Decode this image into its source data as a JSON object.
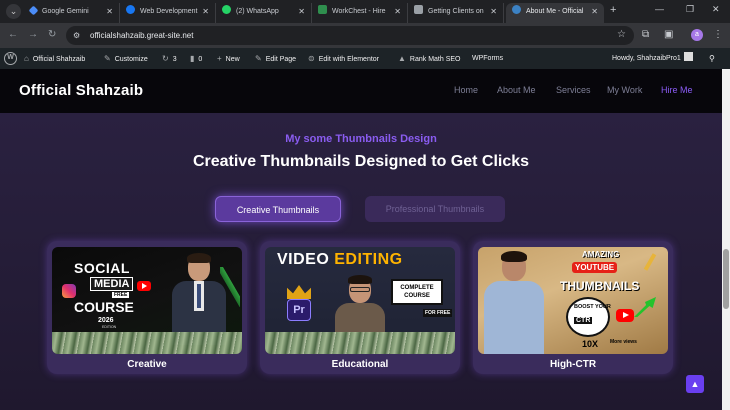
{
  "browser": {
    "tabs": [
      {
        "label": "Google Gemini",
        "favicon_color": "#4b8df8"
      },
      {
        "label": "Web Development",
        "favicon_color": "#1877f2"
      },
      {
        "label": "(2) WhatsApp",
        "favicon_color": "#25d366"
      },
      {
        "label": "WorkChest - Hire",
        "favicon_color": "#2f8f4e"
      },
      {
        "label": "Getting Clients on",
        "favicon_color": "#9aa0a6"
      },
      {
        "label": "About Me - Official",
        "favicon_color": "#3c82c4",
        "active": true
      }
    ],
    "url": "officialshahzaib.great-site.net",
    "profile_initial": "a"
  },
  "adminbar": {
    "site_name": "Official Shahzaib",
    "customize": "Customize",
    "updates_count": "3",
    "comments_count": "0",
    "new": "New",
    "edit_page": "Edit Page",
    "edit_elementor": "Edit with Elementor",
    "rank_math": "Rank Math SEO",
    "wpforms": "WPForms",
    "howdy": "Howdy, ShahzaibPro1"
  },
  "header": {
    "logo": "Official Shahzaib",
    "nav": [
      {
        "label": "Home"
      },
      {
        "label": "About Me"
      },
      {
        "label": "Services"
      },
      {
        "label": "My Work"
      },
      {
        "label": "Hire Me",
        "highlight": true
      }
    ]
  },
  "section": {
    "eyebrow": "My some Thumbnails Design",
    "headline": "Creative Thumbnails Designed to Get Clicks",
    "filters": [
      {
        "label": "Creative Thumbnails",
        "active": true
      },
      {
        "label": "Professional Thumbnails",
        "active": false
      }
    ],
    "cards": [
      {
        "label": "Creative",
        "thumb": {
          "l1": "SOCIAL",
          "l2": "MEDIA",
          "l3": "FREE",
          "l4": "COURSE",
          "l5": "2026",
          "l6": "EDITION"
        }
      },
      {
        "label": "Educational",
        "thumb": {
          "l1a": "VIDEO ",
          "l1b": "EDITING",
          "box": "COMPLETE COURSE",
          "free": "FOR FREE",
          "pr": "Pr"
        }
      },
      {
        "label": "High-CTR",
        "thumb": {
          "l1": "AMAZING",
          "l2": "YOUTUBE",
          "l3": "THUMBNAILS",
          "l4": "BOOST YOUR",
          "ctr": "CTR",
          "l5": "10X",
          "l6": "More views"
        }
      }
    ]
  },
  "colors": {
    "accent": "#8b5cf6",
    "background": "#2a2140",
    "header_bg": "#07060b"
  }
}
